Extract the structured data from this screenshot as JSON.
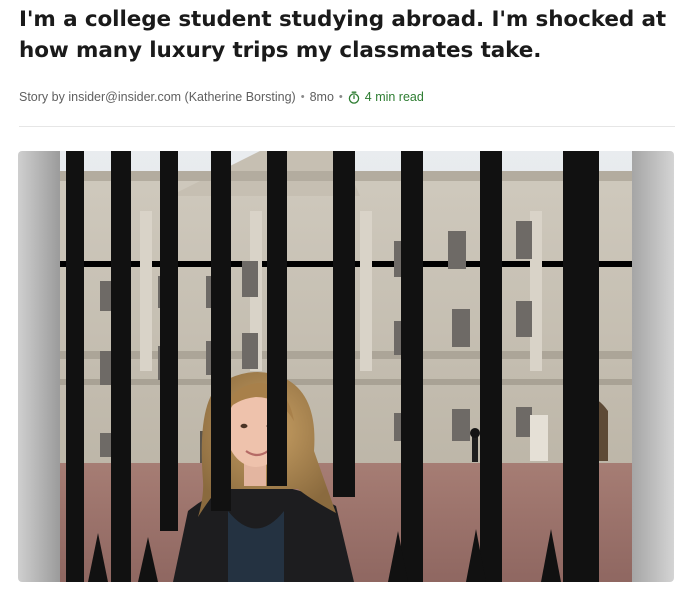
{
  "article": {
    "headline": "I'm a college student studying abroad. I'm shocked at how many luxury trips my classmates take.",
    "byline_prefix": "Story by",
    "author": "insider@insider.com (Katherine Borsting)",
    "age": "8mo",
    "read_time": "4 min read",
    "read_time_icon": "stopwatch-icon",
    "accent_color": "#2e7d32"
  },
  "hero_image": {
    "subject": "woman-in-front-of-palace-gate",
    "scene": "palace-facade-behind-black-iron-railings"
  }
}
